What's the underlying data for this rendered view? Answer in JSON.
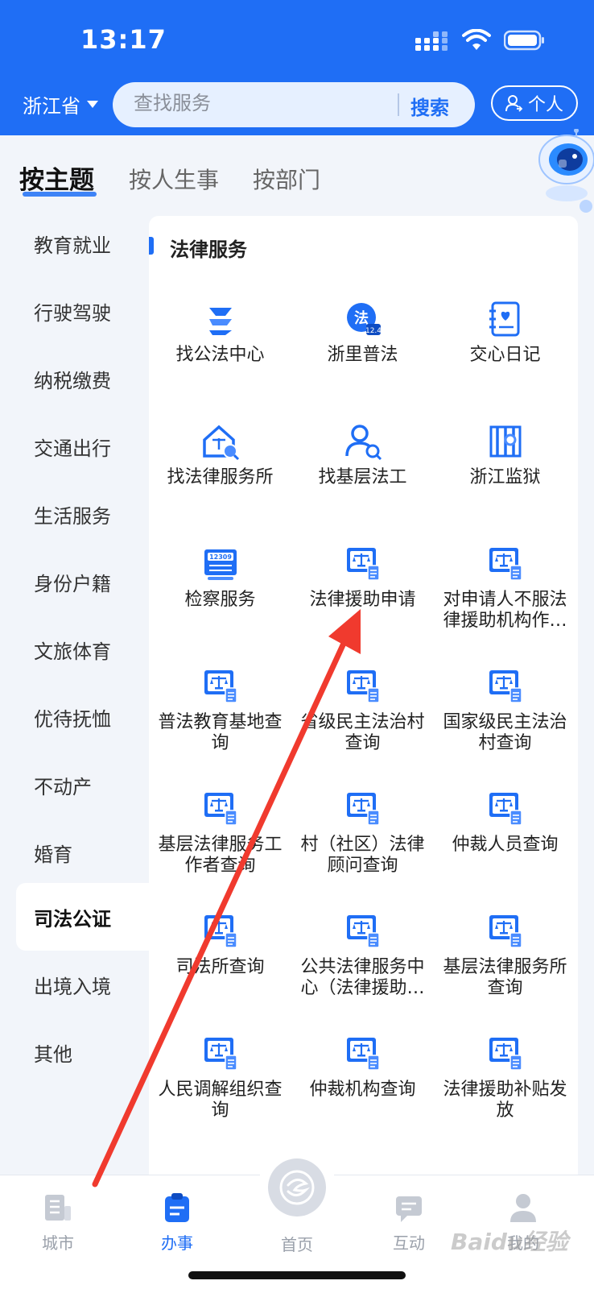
{
  "status_bar": {
    "time": "13:17"
  },
  "header": {
    "province": "浙江省",
    "search_placeholder": "查找服务",
    "search_button": "搜索",
    "personal_button": "个人"
  },
  "category_tabs": [
    {
      "label": "按主题",
      "active": true
    },
    {
      "label": "按人生事",
      "active": false
    },
    {
      "label": "按部门",
      "active": false
    }
  ],
  "sidebar": {
    "items": [
      {
        "label": "教育就业"
      },
      {
        "label": "行驶驾驶"
      },
      {
        "label": "纳税缴费"
      },
      {
        "label": "交通出行"
      },
      {
        "label": "生活服务"
      },
      {
        "label": "身份户籍"
      },
      {
        "label": "文旅体育"
      },
      {
        "label": "优待抚恤"
      },
      {
        "label": "不动产"
      },
      {
        "label": "婚育"
      },
      {
        "label": "司法公证",
        "active": true
      },
      {
        "label": "出境入境"
      },
      {
        "label": "其他"
      }
    ]
  },
  "section": {
    "title": "法律服务",
    "services": [
      {
        "label": "找公法中心",
        "icon": "s-logo-icon"
      },
      {
        "label": "浙里普法",
        "icon": "law-badge-icon"
      },
      {
        "label": "交心日记",
        "icon": "diary-heart-icon"
      },
      {
        "label": "找法律服务所",
        "icon": "house-search-icon"
      },
      {
        "label": "找基层法工",
        "icon": "person-search-icon"
      },
      {
        "label": "浙江监狱",
        "icon": "prison-icon"
      },
      {
        "label": "检察服务",
        "icon": "procuratorate-12309-icon"
      },
      {
        "label": "法律援助申请",
        "icon": "scales-document-icon"
      },
      {
        "label": "对申请人不服法律援助机构作…",
        "icon": "scales-document-icon"
      },
      {
        "label": "普法教育基地查询",
        "icon": "scales-document-icon"
      },
      {
        "label": "省级民主法治村查询",
        "icon": "scales-document-icon"
      },
      {
        "label": "国家级民主法治村查询",
        "icon": "scales-document-icon"
      },
      {
        "label": "基层法律服务工作者查询",
        "icon": "scales-document-icon"
      },
      {
        "label": "村（社区）法律顾问查询",
        "icon": "scales-document-icon"
      },
      {
        "label": "仲裁人员查询",
        "icon": "scales-document-icon"
      },
      {
        "label": "司法所查询",
        "icon": "scales-document-icon"
      },
      {
        "label": "公共法律服务中心（法律援助…",
        "icon": "scales-document-icon"
      },
      {
        "label": "基层法律服务所查询",
        "icon": "scales-document-icon"
      },
      {
        "label": "人民调解组织查询",
        "icon": "scales-document-icon"
      },
      {
        "label": "仲裁机构查询",
        "icon": "scales-document-icon"
      },
      {
        "label": "法律援助补贴发放",
        "icon": "scales-document-icon"
      }
    ]
  },
  "bottom_nav": [
    {
      "label": "城市",
      "icon": "city-icon"
    },
    {
      "label": "办事",
      "icon": "clipboard-icon",
      "active": true
    },
    {
      "label": "首页",
      "icon": "home-logo-icon"
    },
    {
      "label": "互动",
      "icon": "chat-icon"
    },
    {
      "label": "我的",
      "icon": "user-icon"
    }
  ],
  "watermark": "Baidu经验",
  "colors": {
    "primary": "#1f6ef5",
    "background": "#f2f5fa",
    "annotation_arrow": "#f03a2e"
  }
}
